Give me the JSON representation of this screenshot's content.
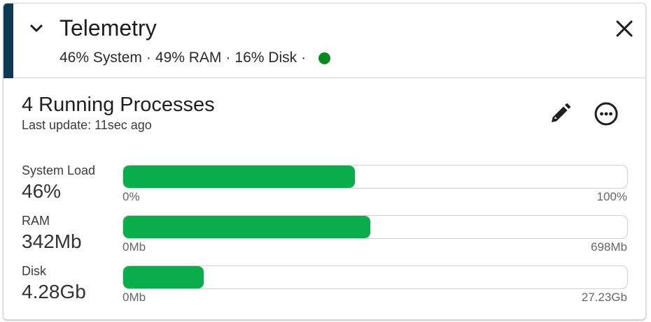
{
  "header": {
    "title": "Telemetry",
    "summary": {
      "system": "46% System",
      "ram": "49% RAM",
      "disk": "16% Disk",
      "separator": "·"
    },
    "status_color": "#0a8a1e",
    "accent_color": "#0b3a52"
  },
  "panel": {
    "title": "4 Running Processes",
    "last_update": "Last update: 11sec ago"
  },
  "icons": {
    "collapse": "chevron-down-icon",
    "close": "close-icon",
    "edit": "pencil-icon",
    "more": "more-icon"
  },
  "metrics": [
    {
      "label": "System Load",
      "value": "46%",
      "min": "0%",
      "max": "100%",
      "fraction": 0.46
    },
    {
      "label": "RAM",
      "value": "342Mb",
      "min": "0Mb",
      "max": "698Mb",
      "fraction": 0.49
    },
    {
      "label": "Disk",
      "value": "4.28Gb",
      "min": "0Mb",
      "max": "27.23Gb",
      "fraction": 0.16
    }
  ],
  "bar_color": "#0aad4c"
}
